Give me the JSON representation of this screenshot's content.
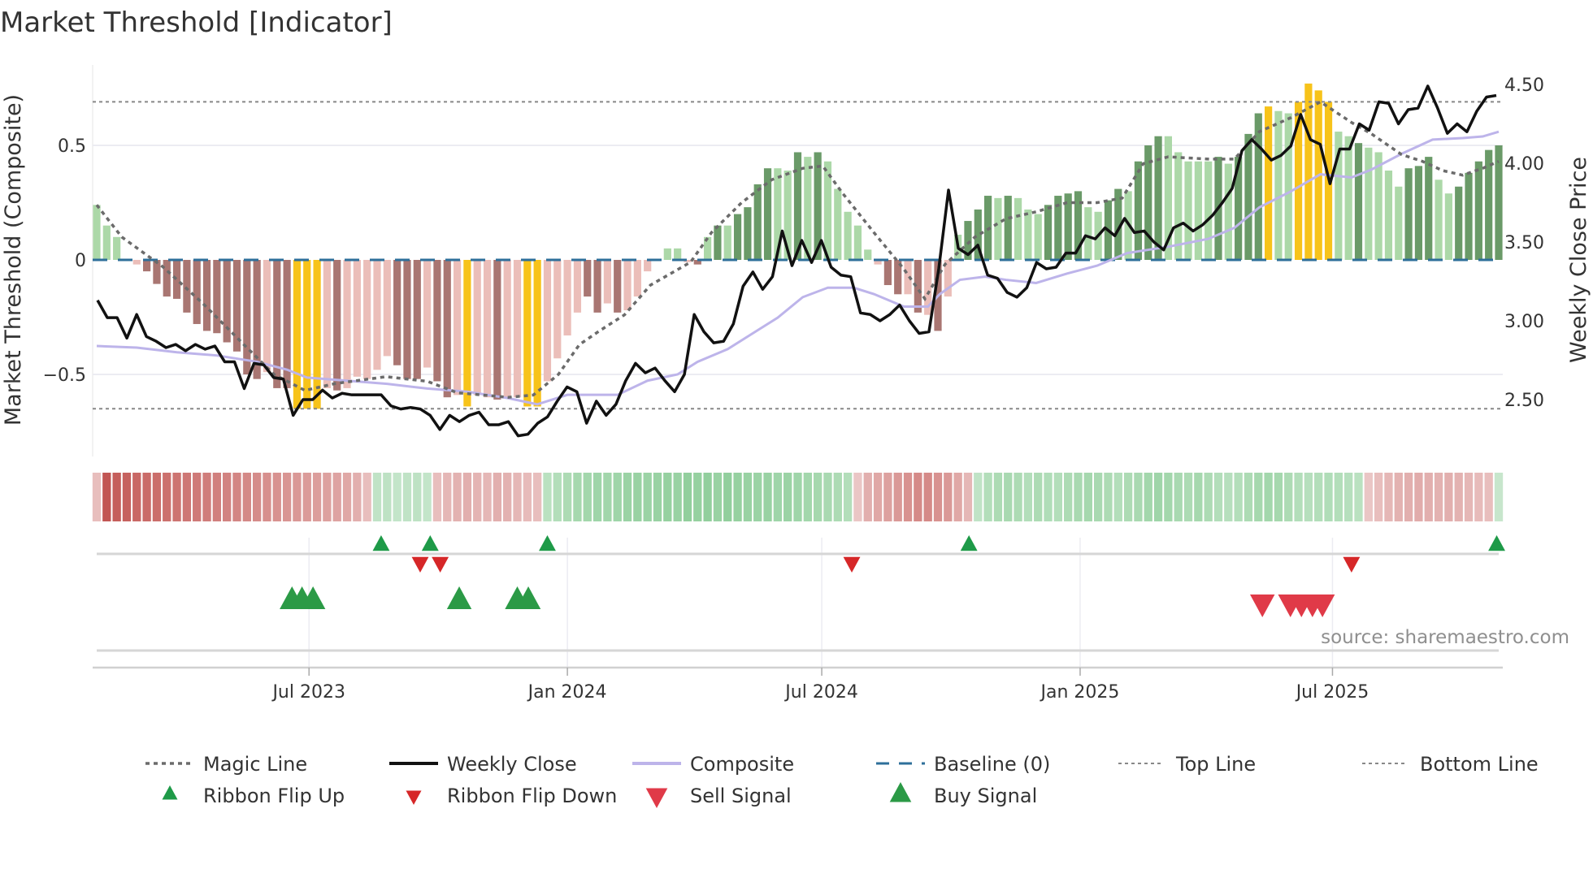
{
  "title": "Market Threshold [Indicator]",
  "source": "source: sharemaestro.com",
  "colors": {
    "bar_pos_dark": "#6a9a68",
    "bar_pos_light": "#acd8a8",
    "bar_neg_dark": "#a97672",
    "bar_neg_light": "#ebbeb9",
    "bar_highlight": "#f7c31a",
    "weekly_close": "#111111",
    "composite": "#bdb4ea",
    "magic": "#6b6b6b",
    "baseline": "#2e6f9a",
    "threshold": "#888888",
    "ribbon_pos": "#6dbf7b",
    "ribbon_neg": "#c0504d",
    "up_marker": "#1e9a48",
    "down_marker": "#d62728",
    "buy": "#2b9a46",
    "sell": "#e03a48"
  },
  "chart_data": {
    "type": "bar",
    "title": "Market Threshold [Indicator]",
    "ylabel": "Market Threshold (Composite)",
    "y2label": "Weekly Close Price",
    "ylim": [
      -0.85,
      0.85
    ],
    "y2lim": [
      2.1,
      4.6
    ],
    "x_unit": "week index",
    "x_ticks": [
      {
        "week": 21.2,
        "label": "Jul 2023"
      },
      {
        "week": 47,
        "label": "Jan 2024"
      },
      {
        "week": 72.4,
        "label": "Jul 2024"
      },
      {
        "week": 98.2,
        "label": "Jan 2025"
      },
      {
        "week": 123.4,
        "label": "Jul 2025"
      }
    ],
    "y_ticks": [
      {
        "value": 0.5,
        "label": "0.5"
      },
      {
        "value": 0,
        "label": "0"
      },
      {
        "value": -0.5,
        "label": "−0.5"
      }
    ],
    "y2_ticks": [
      {
        "value": 4.5,
        "label": "4.50"
      },
      {
        "value": 4.0,
        "label": "4.00"
      },
      {
        "value": 3.5,
        "label": "3.50"
      },
      {
        "value": 3.0,
        "label": "3.00"
      },
      {
        "value": 2.5,
        "label": "2.50"
      }
    ],
    "top_line": 0.69,
    "bottom_line": -0.65,
    "baseline": 0,
    "composite_bars": [
      0.24,
      0.15,
      0.1,
      -0.005,
      -0.02,
      -0.05,
      -0.105,
      -0.16,
      -0.17,
      -0.23,
      -0.28,
      -0.31,
      -0.32,
      -0.36,
      -0.4,
      -0.5,
      -0.52,
      -0.49,
      -0.56,
      -0.56,
      -0.65,
      -0.65,
      -0.65,
      -0.56,
      -0.57,
      -0.56,
      -0.51,
      -0.52,
      -0.48,
      -0.42,
      -0.46,
      -0.52,
      -0.52,
      -0.47,
      -0.53,
      -0.6,
      -0.59,
      -0.64,
      -0.59,
      -0.6,
      -0.61,
      -0.6,
      -0.6,
      -0.64,
      -0.64,
      -0.53,
      -0.43,
      -0.33,
      -0.23,
      -0.16,
      -0.23,
      -0.19,
      -0.23,
      -0.22,
      -0.16,
      -0.05,
      0,
      0.05,
      0.05,
      -0.01,
      -0.02,
      0.1,
      0.15,
      0.15,
      0.2,
      0.23,
      0.33,
      0.4,
      0.4,
      0.39,
      0.47,
      0.45,
      0.47,
      0.43,
      0.31,
      0.21,
      0.15,
      0.045,
      -0.02,
      -0.11,
      -0.15,
      -0.15,
      -0.23,
      -0.24,
      -0.31,
      -0.16,
      0.11,
      0.17,
      0.22,
      0.28,
      0.27,
      0.28,
      0.27,
      0.22,
      0.2,
      0.24,
      0.28,
      0.29,
      0.3,
      0.23,
      0.21,
      0.26,
      0.31,
      0.3,
      0.43,
      0.5,
      0.54,
      0.54,
      0.47,
      0.43,
      0.43,
      0.43,
      0.45,
      0.42,
      0.45,
      0.55,
      0.64,
      0.67,
      0.65,
      0.64,
      0.69,
      0.77,
      0.74,
      0.69,
      0.56,
      0.54,
      0.51,
      0.49,
      0.47,
      0.39,
      0.32,
      0.4,
      0.41,
      0.45,
      0.35,
      0.29,
      0.32,
      0.38,
      0.43,
      0.48,
      0.5
    ],
    "bar_shade": [
      0,
      0,
      0,
      0,
      0,
      1,
      1,
      1,
      1,
      1,
      1,
      1,
      1,
      1,
      1,
      1,
      1,
      0,
      1,
      1,
      2,
      2,
      2,
      0,
      1,
      0,
      0,
      0,
      0,
      0,
      1,
      1,
      1,
      0,
      1,
      1,
      0,
      2,
      0,
      0,
      1,
      0,
      0,
      2,
      2,
      0,
      0,
      0,
      0,
      1,
      1,
      0,
      1,
      0,
      0,
      0,
      0,
      0,
      0,
      0,
      1,
      0,
      1,
      0,
      1,
      1,
      1,
      1,
      0,
      0,
      1,
      0,
      1,
      0,
      0,
      0,
      0,
      0,
      0,
      1,
      1,
      0,
      1,
      0,
      1,
      0,
      0,
      1,
      1,
      1,
      0,
      1,
      0,
      0,
      0,
      1,
      1,
      1,
      1,
      0,
      0,
      1,
      1,
      0,
      1,
      1,
      1,
      0,
      0,
      0,
      0,
      0,
      1,
      0,
      1,
      1,
      1,
      2,
      0,
      0,
      2,
      2,
      2,
      2,
      0,
      0,
      1,
      0,
      0,
      0,
      0,
      1,
      1,
      1,
      0,
      0,
      1,
      1,
      1,
      1,
      1
    ],
    "weekly_close": [
      3.13,
      3.02,
      3.02,
      2.89,
      3.04,
      2.9,
      2.87,
      2.83,
      2.85,
      2.81,
      2.85,
      2.82,
      2.84,
      2.74,
      2.74,
      2.57,
      2.73,
      2.72,
      2.64,
      2.63,
      2.4,
      2.5,
      2.5,
      2.56,
      2.51,
      2.54,
      2.53,
      2.53,
      2.53,
      2.53,
      2.46,
      2.44,
      2.45,
      2.44,
      2.4,
      2.31,
      2.4,
      2.36,
      2.4,
      2.42,
      2.34,
      2.34,
      2.36,
      2.27,
      2.28,
      2.35,
      2.39,
      2.49,
      2.58,
      2.55,
      2.35,
      2.49,
      2.4,
      2.47,
      2.62,
      2.73,
      2.67,
      2.7,
      2.62,
      2.55,
      2.66,
      3.04,
      2.93,
      2.86,
      2.87,
      2.98,
      3.22,
      3.31,
      3.2,
      3.28,
      3.57,
      3.35,
      3.51,
      3.37,
      3.51,
      3.34,
      3.29,
      3.28,
      3.05,
      3.04,
      3.0,
      3.04,
      3.1,
      3.0,
      2.92,
      2.93,
      3.33,
      3.83,
      3.46,
      3.42,
      3.48,
      3.29,
      3.27,
      3.18,
      3.15,
      3.21,
      3.37,
      3.33,
      3.34,
      3.43,
      3.43,
      3.54,
      3.52,
      3.59,
      3.54,
      3.65,
      3.56,
      3.57,
      3.5,
      3.45,
      3.59,
      3.62,
      3.57,
      3.61,
      3.67,
      3.75,
      3.84,
      4.08,
      4.15,
      4.09,
      4.02,
      4.05,
      4.11,
      4.31,
      4.15,
      4.12,
      3.87,
      4.09,
      4.09,
      4.25,
      4.21,
      4.39,
      4.38,
      4.25,
      4.34,
      4.35,
      4.49,
      4.35,
      4.19,
      4.25,
      4.2,
      4.33,
      4.42,
      4.43
    ],
    "composite_line": [
      [
        0,
        2.84
      ],
      [
        4,
        2.83
      ],
      [
        8,
        2.8
      ],
      [
        12,
        2.78
      ],
      [
        16,
        2.74
      ],
      [
        19,
        2.69
      ],
      [
        21,
        2.64
      ],
      [
        25,
        2.62
      ],
      [
        29,
        2.6
      ],
      [
        33,
        2.57
      ],
      [
        37,
        2.55
      ],
      [
        41,
        2.51
      ],
      [
        44,
        2.47
      ],
      [
        47,
        2.53
      ],
      [
        50,
        2.53
      ],
      [
        52,
        2.53
      ],
      [
        55,
        2.62
      ],
      [
        58,
        2.66
      ],
      [
        60,
        2.74
      ],
      [
        63,
        2.82
      ],
      [
        66,
        2.94
      ],
      [
        68,
        3.02
      ],
      [
        70.5,
        3.15
      ],
      [
        73,
        3.21
      ],
      [
        75.6,
        3.21
      ],
      [
        77.6,
        3.17
      ],
      [
        80.6,
        3.09
      ],
      [
        83,
        3.09
      ],
      [
        84.2,
        3.17
      ],
      [
        86.2,
        3.26
      ],
      [
        88.7,
        3.28
      ],
      [
        90.8,
        3.26
      ],
      [
        93.8,
        3.24
      ],
      [
        96.9,
        3.3
      ],
      [
        99.9,
        3.35
      ],
      [
        102.9,
        3.43
      ],
      [
        107,
        3.47
      ],
      [
        111,
        3.52
      ],
      [
        113.6,
        3.59
      ],
      [
        116.1,
        3.72
      ],
      [
        119.2,
        3.82
      ],
      [
        122.2,
        3.93
      ],
      [
        125.3,
        3.91
      ],
      [
        127.3,
        3.96
      ],
      [
        130.3,
        4.06
      ],
      [
        133.4,
        4.15
      ],
      [
        136.4,
        4.16
      ],
      [
        138.4,
        4.17
      ],
      [
        140,
        4.2
      ]
    ],
    "magic_line": [
      [
        0,
        0.24
      ],
      [
        2.5,
        0.1
      ],
      [
        6.6,
        -0.03
      ],
      [
        10.6,
        -0.19
      ],
      [
        14.7,
        -0.37
      ],
      [
        17.7,
        -0.5
      ],
      [
        20.8,
        -0.57
      ],
      [
        23.8,
        -0.54
      ],
      [
        28.9,
        -0.51
      ],
      [
        33,
        -0.53
      ],
      [
        36,
        -0.58
      ],
      [
        41.1,
        -0.6
      ],
      [
        43.6,
        -0.59
      ],
      [
        46.1,
        -0.5
      ],
      [
        48.2,
        -0.37
      ],
      [
        50.2,
        -0.31
      ],
      [
        52.7,
        -0.24
      ],
      [
        55.3,
        -0.11
      ],
      [
        57.3,
        -0.06
      ],
      [
        59.3,
        -0.01
      ],
      [
        61.4,
        0.12
      ],
      [
        64.4,
        0.25
      ],
      [
        67.4,
        0.35
      ],
      [
        70.5,
        0.4
      ],
      [
        72.5,
        0.41
      ],
      [
        74.5,
        0.29
      ],
      [
        77.6,
        0.12
      ],
      [
        80.6,
        -0.04
      ],
      [
        82.7,
        -0.17
      ],
      [
        84.7,
        -0.02
      ],
      [
        87.7,
        0.1
      ],
      [
        90.8,
        0.18
      ],
      [
        93.8,
        0.21
      ],
      [
        96.9,
        0.25
      ],
      [
        99.9,
        0.25
      ],
      [
        102.4,
        0.27
      ],
      [
        104.5,
        0.42
      ],
      [
        107,
        0.45
      ],
      [
        111.1,
        0.44
      ],
      [
        113.6,
        0.44
      ],
      [
        116.1,
        0.56
      ],
      [
        119.2,
        0.62
      ],
      [
        122.2,
        0.69
      ],
      [
        125.3,
        0.6
      ],
      [
        127.3,
        0.55
      ],
      [
        130.3,
        0.46
      ],
      [
        132.4,
        0.43
      ],
      [
        134.4,
        0.39
      ],
      [
        136.4,
        0.37
      ],
      [
        138.4,
        0.4
      ],
      [
        140,
        0.43
      ]
    ],
    "ribbon": [
      -0.2,
      -0.9,
      -0.85,
      -0.82,
      -0.78,
      -0.76,
      -0.74,
      -0.72,
      -0.7,
      -0.68,
      -0.66,
      -0.64,
      -0.62,
      -0.6,
      -0.58,
      -0.56,
      -0.54,
      -0.52,
      -0.5,
      -0.48,
      -0.46,
      -0.44,
      -0.42,
      -0.4,
      -0.38,
      -0.35,
      -0.3,
      -0.2,
      0.2,
      0.22,
      0.18,
      0.2,
      0.22,
      0.18,
      -0.2,
      -0.25,
      -0.28,
      -0.3,
      -0.27,
      -0.25,
      -0.3,
      -0.28,
      -0.25,
      -0.22,
      -0.2,
      0.25,
      0.3,
      0.35,
      0.4,
      0.42,
      0.45,
      0.43,
      0.45,
      0.48,
      0.5,
      0.48,
      0.5,
      0.52,
      0.5,
      0.55,
      0.52,
      0.55,
      0.5,
      0.55,
      0.52,
      0.5,
      0.48,
      0.5,
      0.45,
      0.48,
      0.45,
      0.42,
      0.4,
      0.38,
      0.35,
      0.3,
      -0.15,
      -0.3,
      -0.35,
      -0.4,
      -0.45,
      -0.5,
      -0.55,
      -0.55,
      -0.5,
      -0.45,
      -0.35,
      -0.25,
      0.2,
      0.3,
      0.35,
      0.38,
      0.35,
      0.3,
      0.35,
      0.32,
      0.3,
      0.35,
      0.38,
      0.4,
      0.38,
      0.35,
      0.3,
      0.35,
      0.38,
      0.42,
      0.45,
      0.42,
      0.38,
      0.35,
      0.4,
      0.35,
      0.3,
      0.28,
      0.3,
      0.35,
      0.4,
      0.42,
      0.4,
      0.35,
      0.3,
      0.28,
      0.3,
      0.32,
      0.3,
      0.28,
      0.25,
      -0.15,
      -0.2,
      -0.25,
      -0.28,
      -0.3,
      -0.32,
      -0.3,
      -0.28,
      -0.3,
      -0.28,
      -0.25,
      -0.22,
      -0.2,
      0.15
    ],
    "ribbon_flip_up": [
      28.4,
      33.3,
      45,
      87.1,
      139.8
    ],
    "ribbon_flip_down": [
      32.3,
      34.3,
      75.4,
      125.3
    ],
    "buy_signals": [
      19.5,
      20.5,
      21.6,
      36.2,
      42,
      43.1
    ],
    "sell_signals": [
      116.4,
      119.2,
      120.3,
      121.4,
      122.4
    ],
    "legend_position": "bottom",
    "legend": [
      {
        "key": "magic",
        "label": "Magic Line"
      },
      {
        "key": "close",
        "label": "Weekly Close"
      },
      {
        "key": "composite",
        "label": "Composite"
      },
      {
        "key": "baseline",
        "label": "Baseline (0)"
      },
      {
        "key": "top",
        "label": "Top Line"
      },
      {
        "key": "bottom",
        "label": "Bottom Line"
      },
      {
        "key": "flipup",
        "label": "Ribbon Flip Up"
      },
      {
        "key": "flipdown",
        "label": "Ribbon Flip Down"
      },
      {
        "key": "sell",
        "label": "Sell Signal"
      },
      {
        "key": "buy",
        "label": "Buy Signal"
      }
    ]
  }
}
